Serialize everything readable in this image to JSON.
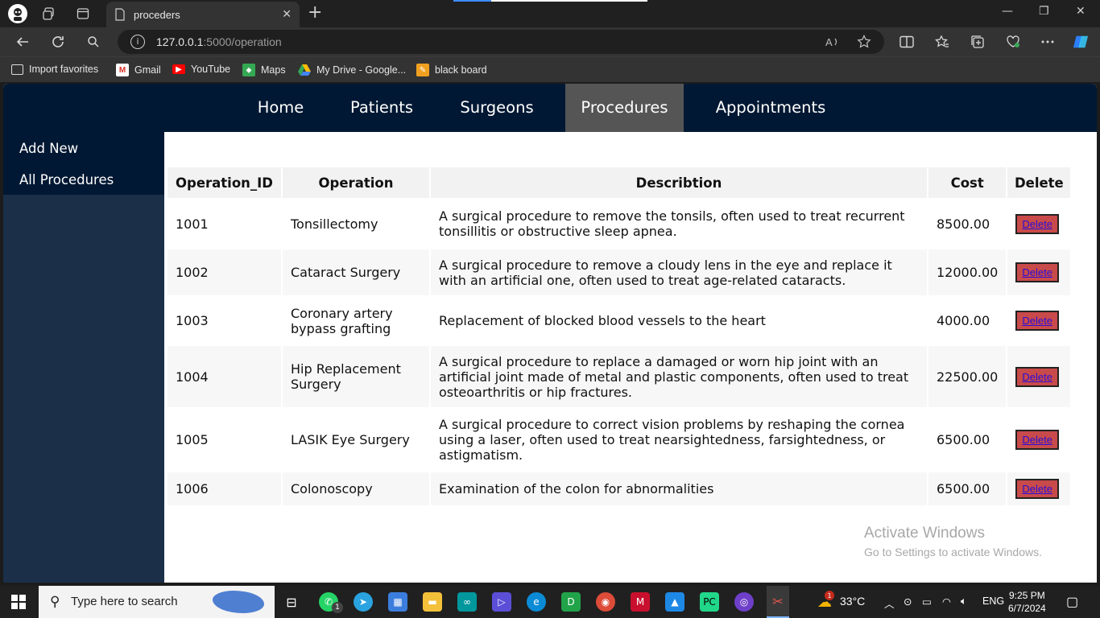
{
  "browser": {
    "tab_title": "proceders",
    "url_host": "127.0.0.1",
    "url_rest": ":5000/operation",
    "bookmarks": [
      {
        "label": "Import favorites",
        "icon": "import-icon"
      },
      {
        "label": "Gmail",
        "icon": "gmail-icon"
      },
      {
        "label": "YouTube",
        "icon": "youtube-icon"
      },
      {
        "label": "Maps",
        "icon": "maps-icon"
      },
      {
        "label": "My Drive - Google...",
        "icon": "drive-icon"
      },
      {
        "label": "black board",
        "icon": "blackboard-icon"
      }
    ]
  },
  "nav": {
    "items": [
      "Home",
      "Patients",
      "Surgeons",
      "Procedures",
      "Appointments"
    ],
    "active": "Procedures"
  },
  "sidebar": {
    "items": [
      "Add New",
      "All Procedures"
    ]
  },
  "table": {
    "headers": [
      "Operation_ID",
      "Operation",
      "Describtion",
      "Cost",
      "Delete"
    ],
    "rows": [
      {
        "id": "1001",
        "operation": "Tonsillectomy",
        "description": "A surgical procedure to remove the tonsils, often used to treat recurrent tonsillitis or obstructive sleep apnea.",
        "cost": "8500.00",
        "delete": "Delete"
      },
      {
        "id": "1002",
        "operation": "Cataract Surgery",
        "description": "A surgical procedure to remove a cloudy lens in the eye and replace it with an artificial one, often used to treat age-related cataracts.",
        "cost": "12000.00",
        "delete": "Delete"
      },
      {
        "id": "1003",
        "operation": "Coronary artery bypass grafting",
        "description": "Replacement of blocked blood vessels to the heart",
        "cost": "4000.00",
        "delete": "Delete"
      },
      {
        "id": "1004",
        "operation": "Hip Replacement Surgery",
        "description": "A surgical procedure to replace a damaged or worn hip joint with an artificial joint made of metal and plastic components, often used to treat osteoarthritis or hip fractures.",
        "cost": "22500.00",
        "delete": "Delete"
      },
      {
        "id": "1005",
        "operation": "LASIK Eye Surgery",
        "description": "A surgical procedure to correct vision problems by reshaping the cornea using a laser, often used to treat nearsightedness, farsightedness, or astigmatism.",
        "cost": "6500.00",
        "delete": "Delete"
      },
      {
        "id": "1006",
        "operation": "Colonoscopy",
        "description": "Examination of the colon for abnormalities",
        "cost": "6500.00",
        "delete": "Delete"
      }
    ]
  },
  "watermark": {
    "title": "Activate Windows",
    "subtitle": "Go to Settings to activate Windows."
  },
  "taskbar": {
    "search_placeholder": "Type here to search",
    "whatsapp_badge": "1",
    "weather_badge": "1",
    "temperature": "33°C",
    "language": "ENG",
    "time": "9:25 PM",
    "date": "6/7/2024"
  },
  "colors": {
    "nav_bg": "#001833",
    "sidebar_bg": "#1b2f48",
    "active_nav": "#555555",
    "delete_bg": "#c94a4a"
  }
}
